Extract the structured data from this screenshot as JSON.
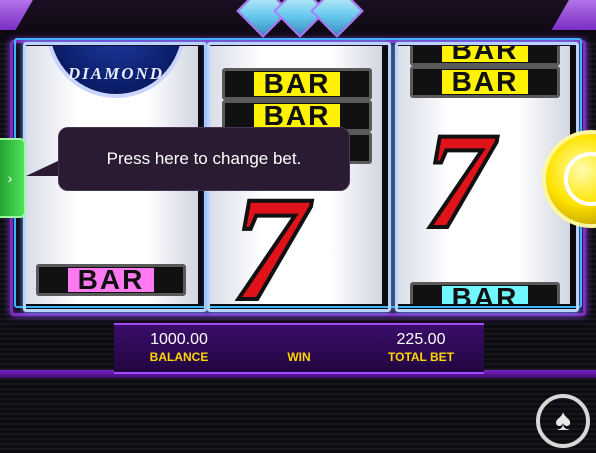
{
  "game": {
    "tooltip_text": "Press here to change bet.",
    "logo_text": "DIAMOND",
    "symbol_bar": "BAR",
    "symbol_seven": "7"
  },
  "status": {
    "balance_value": "1000.00",
    "balance_label": "BALANCE",
    "win_value": "",
    "win_label": "WIN",
    "total_bet_value": "225.00",
    "total_bet_label": "TOTAL BET"
  },
  "icons": {
    "bet_button": "chevron-right-icon",
    "spin_button": "spin-icon",
    "provider_logo": "spade-logo-icon"
  },
  "colors": {
    "frame": "#7a2fbf",
    "bar_yellow": "#fff200",
    "bar_pink": "#ff7af0",
    "bar_cyan": "#6ff6ff",
    "seven_red": "#e0121a",
    "label_yellow": "#ffd600"
  }
}
